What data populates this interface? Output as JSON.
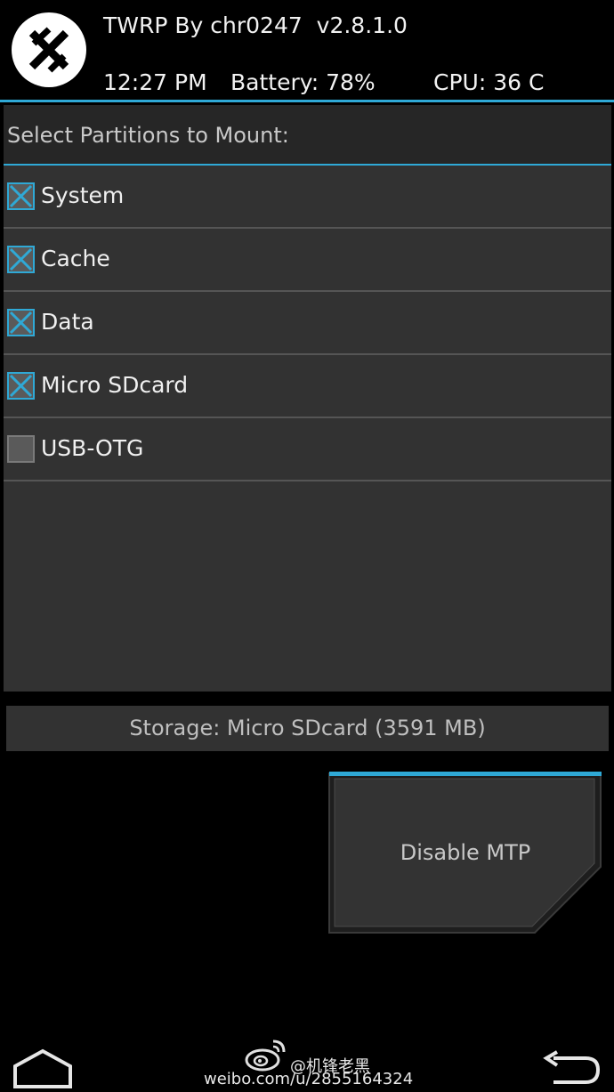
{
  "header": {
    "title": "TWRP By chr0247  v2.8.1.0",
    "time": "12:27 PM",
    "battery": "Battery: 78%",
    "cpu": "CPU: 36 C",
    "logo_icon": "twrp-logo-icon"
  },
  "panel": {
    "heading": "Select Partitions to Mount:",
    "partitions": [
      {
        "label": "System",
        "checked": true
      },
      {
        "label": "Cache",
        "checked": true
      },
      {
        "label": "Data",
        "checked": true
      },
      {
        "label": "Micro SDcard",
        "checked": true
      },
      {
        "label": "USB-OTG",
        "checked": false
      }
    ]
  },
  "storage": {
    "label": "Storage: Micro SDcard (3591 MB)"
  },
  "mtp_button": {
    "label": "Disable MTP"
  },
  "nav": {
    "home_icon": "home-icon",
    "back_icon": "back-arrow-icon"
  },
  "watermark": {
    "handle": "@机锋老黑",
    "url": "weibo.com/u/2855164324",
    "icon": "weibo-logo-icon"
  },
  "colors": {
    "accent": "#2fa9d6",
    "panel": "#323232",
    "panel_head": "#262626",
    "background": "#000000"
  }
}
